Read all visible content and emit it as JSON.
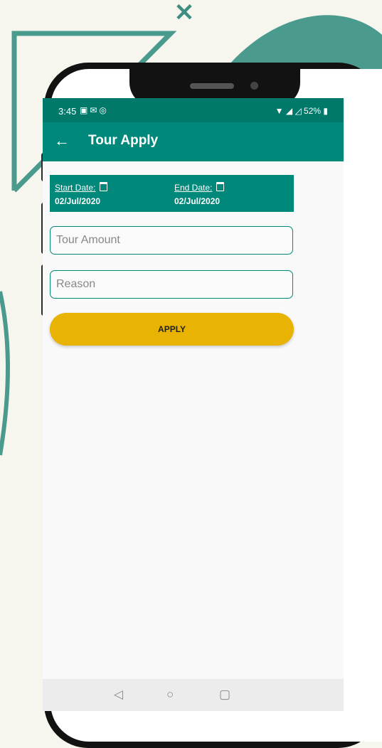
{
  "status_bar": {
    "time": "3:45",
    "notif_icons": [
      "calendar-icon",
      "chat-icon",
      "instagram-icon"
    ],
    "battery": "52%"
  },
  "app_bar": {
    "back_icon": "arrow-left-icon",
    "title": "Tour Apply"
  },
  "dates": {
    "start_label": "Start Date:",
    "start_value": "02/Jul/2020",
    "end_label": "End Date:",
    "end_value": "02/Jul/2020"
  },
  "form": {
    "tour_amount_placeholder": "Tour Amount",
    "reason_placeholder": "Reason",
    "apply_label": "APPLY"
  },
  "nav": {
    "back_icon": "triangle-back-icon",
    "home_icon": "circle-home-icon",
    "recents_icon": "square-recents-icon"
  },
  "colors": {
    "primary": "#00897b",
    "primary_dark": "#00796b",
    "accent": "#e8b303",
    "decoration": "#3f8e84"
  }
}
